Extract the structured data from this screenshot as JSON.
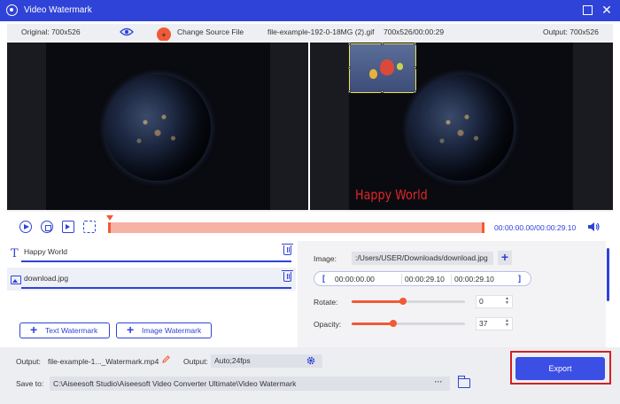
{
  "window": {
    "title": "Video Watermark",
    "controls": {
      "maximize_icon": "maximize-icon",
      "close_icon": "close-icon",
      "close_glyph": "✕"
    }
  },
  "infobar": {
    "original": "Original: 700x526",
    "change_source": "Change Source File",
    "filename": "file-example-192-0-18MG (2).gif",
    "meta": "700x526/00:00:29",
    "output": "Output: 700x526"
  },
  "preview": {
    "watermark_text": "Happy World"
  },
  "player": {
    "timecode": "00:00:00.00/00:00:29.10"
  },
  "watermarks": {
    "items": [
      {
        "label": "Happy World",
        "type": "text"
      },
      {
        "label": "download.jpg",
        "type": "image"
      }
    ],
    "add_text_label": "Text Watermark",
    "add_image_label": "Image Watermark"
  },
  "settings": {
    "image_label": "Image:",
    "image_path": ":/Users/USER/Downloads/download.jpg",
    "start_time": "00:00:00.00",
    "duration": "00:00:29.10",
    "end_time": "00:00:29.10",
    "rotate_label": "Rotate:",
    "rotate_value": "0",
    "rotate_fraction": 0.45,
    "opacity_label": "Opacity:",
    "opacity_value": "37",
    "opacity_fraction": 0.37
  },
  "bottom": {
    "output_label": "Output:",
    "output_file": "file-example-1..._Watermark.mp4",
    "format_label": "Output:",
    "format_value": "Auto;24fps",
    "save_label": "Save to:",
    "save_path": "C:\\Aiseesoft Studio\\Aiseesoft Video Converter Ultimate\\Video Watermark",
    "more_label": "···",
    "export_label": "Export"
  },
  "colors": {
    "accent": "#2f43d8",
    "orange": "#f05a36",
    "watermark_text": "#e02626",
    "export_highlight": "#d42020"
  }
}
